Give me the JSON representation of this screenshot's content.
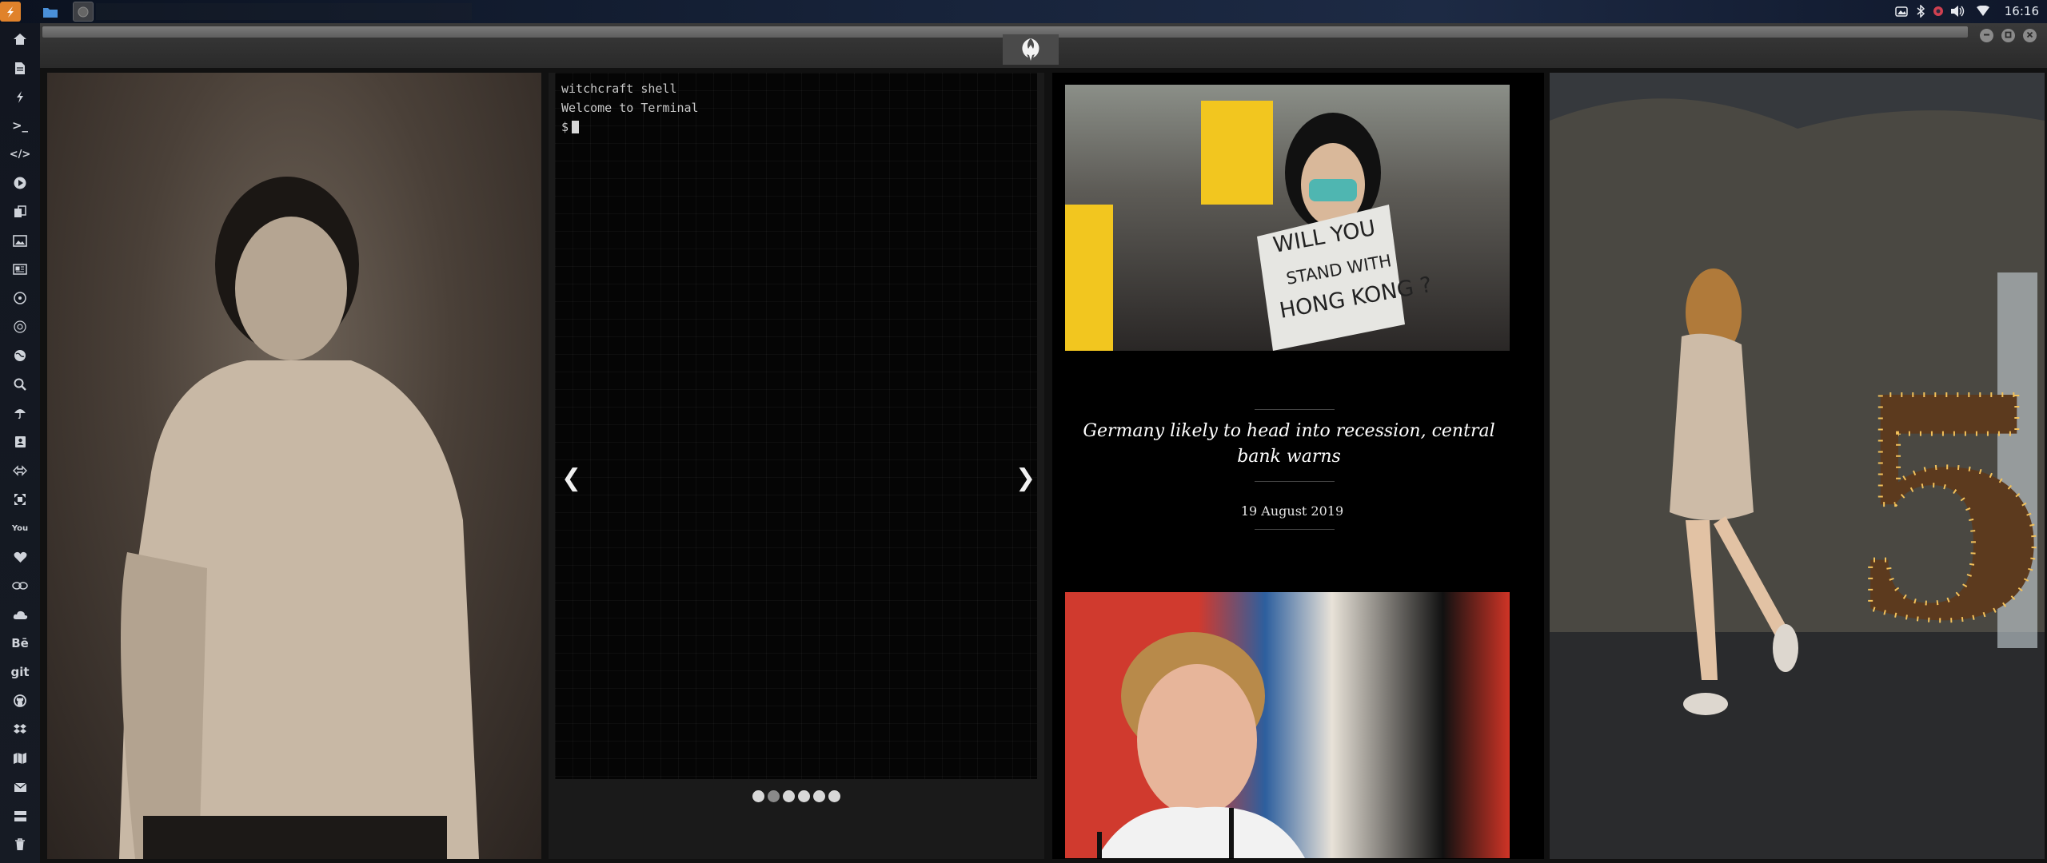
{
  "taskbar": {
    "clock": "16:16",
    "apps": [
      "menu-icon",
      "files-icon",
      "active-window-icon"
    ],
    "tray": [
      "screenshot-icon",
      "bluetooth-icon",
      "settings-icon",
      "volume-icon",
      "wifi-icon"
    ]
  },
  "sidebar": {
    "items": [
      {
        "icon": "home-icon"
      },
      {
        "icon": "document-icon"
      },
      {
        "icon": "bolt-icon"
      },
      {
        "icon": "terminal-icon",
        "label": ">_"
      },
      {
        "icon": "code-icon",
        "label": "</>"
      },
      {
        "icon": "play-icon"
      },
      {
        "icon": "copy-icon"
      },
      {
        "icon": "image-icon"
      },
      {
        "icon": "news-icon"
      },
      {
        "icon": "rebel-icon"
      },
      {
        "icon": "empire-icon"
      },
      {
        "icon": "globe-icon"
      },
      {
        "icon": "search-icon"
      },
      {
        "icon": "umbrella-icon"
      },
      {
        "icon": "contact-icon"
      },
      {
        "icon": "shuffle-icon"
      },
      {
        "icon": "expand-icon"
      },
      {
        "icon": "youtube-icon",
        "label": "You"
      },
      {
        "icon": "heart-icon"
      },
      {
        "icon": "cloud-link-icon"
      },
      {
        "icon": "cloud-icon"
      },
      {
        "icon": "behance-icon",
        "label": "Bē"
      },
      {
        "icon": "git-icon",
        "label": "git"
      },
      {
        "icon": "github-icon"
      },
      {
        "icon": "dropbox-icon"
      },
      {
        "icon": "map-icon"
      },
      {
        "icon": "mail-icon"
      },
      {
        "icon": "server-icon"
      },
      {
        "icon": "trash-icon"
      }
    ]
  },
  "window": {
    "emblem": "rebel-alliance-icon",
    "controls": [
      "minimize",
      "maximize",
      "close"
    ]
  },
  "terminal": {
    "line1": "witchcraft shell",
    "line2": "Welcome to Terminal",
    "prompt": "$",
    "prev_arrow": "❮",
    "next_arrow": "❯",
    "slides": 6,
    "active_slide": 2
  },
  "news": {
    "headline": "Germany likely to head into recession, central bank warns",
    "date": "19 August 2019",
    "sign_text_lines": [
      "WILL YOU",
      "STAND WITH",
      "HONG KONG ?"
    ]
  },
  "photos": {
    "right_photo_number": "5"
  }
}
